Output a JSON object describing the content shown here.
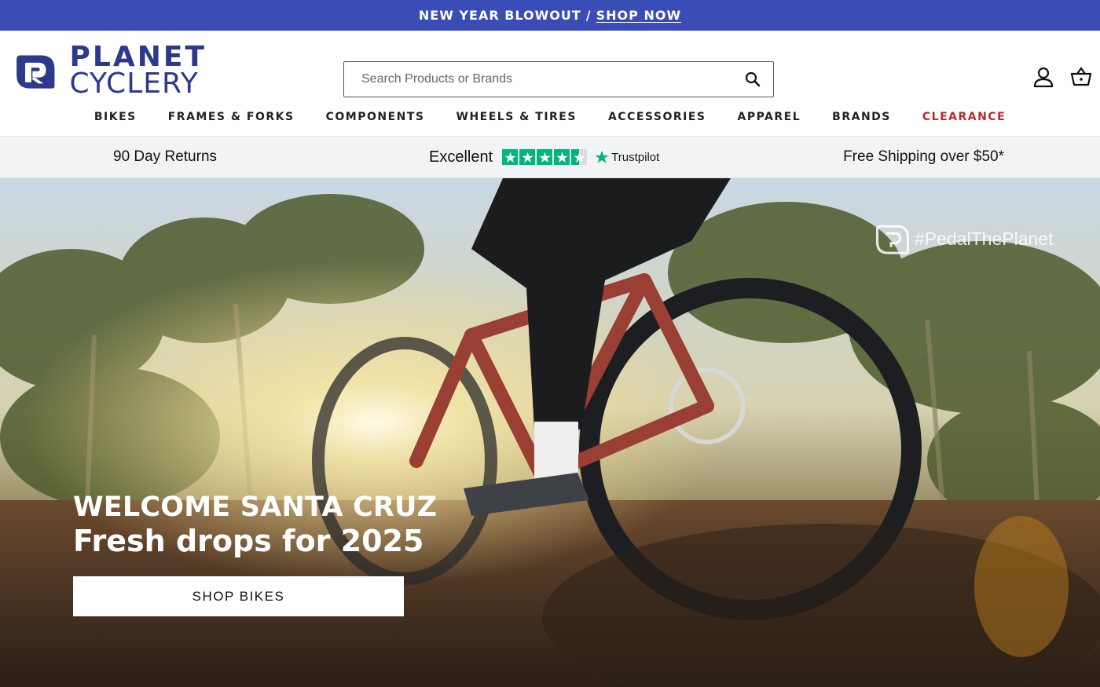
{
  "announcement": {
    "text": "NEW YEAR BLOWOUT",
    "separator": "/",
    "link": "SHOP NOW",
    "bg_color": "#3a4db6"
  },
  "header": {
    "logo": {
      "line1": "PLANET",
      "line2": "CYCLERY",
      "color": "#2b3a8c"
    },
    "search": {
      "placeholder": "Search Products or Brands"
    },
    "icons": [
      "search-icon",
      "account-icon",
      "cart-icon"
    ]
  },
  "nav": {
    "items": [
      {
        "label": "BIKES"
      },
      {
        "label": "FRAMES & FORKS"
      },
      {
        "label": "COMPONENTS"
      },
      {
        "label": "WHEELS & TIRES"
      },
      {
        "label": "ACCESSORIES"
      },
      {
        "label": "APPAREL"
      },
      {
        "label": "BRANDS"
      },
      {
        "label": "CLEARANCE",
        "color": "#c0272d"
      }
    ]
  },
  "trust_bar": {
    "returns": "90 Day Returns",
    "rating_label": "Excellent",
    "rating_stars": 4.5,
    "provider": "Trustpilot",
    "shipping": "Free Shipping over $50*",
    "star_color": "#00b67a"
  },
  "hero": {
    "hashtag": "#PedalThePlanet",
    "headline_line1": "WELCOME SANTA CRUZ",
    "headline_line2": "Fresh drops for 2025",
    "cta": "SHOP BIKES"
  }
}
